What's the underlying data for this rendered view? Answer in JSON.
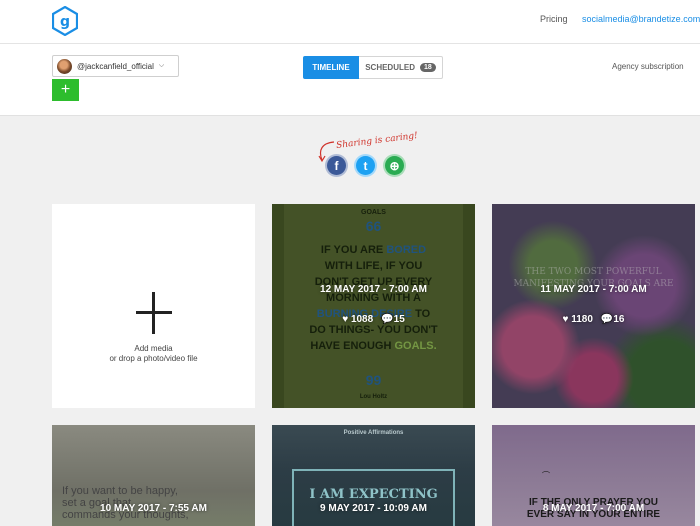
{
  "header": {
    "logo_letter": "g",
    "pricing_label": "Pricing",
    "account_email": "socialmedia@brandetize.com"
  },
  "subheader": {
    "account_handle": "@jackcanfield_official",
    "add_label": "+",
    "tabs": [
      {
        "label": "TIMELINE",
        "active": true
      },
      {
        "label": "SCHEDULED",
        "count": "18",
        "active": false
      }
    ],
    "agency_label": "Agency subscription"
  },
  "share": {
    "caption": "Sharing is caring!",
    "icons": [
      "facebook-icon",
      "twitter-icon",
      "more-share-icon"
    ],
    "facebook_glyph": "f",
    "twitter_glyph": "t",
    "more_glyph": "⊕"
  },
  "add_card": {
    "line1": "Add media",
    "line2": "or drop a photo/video file"
  },
  "posts": [
    {
      "date": "12 MAY 2017 - 7:00 AM",
      "likes": "1088",
      "comments": "15",
      "image": {
        "title": "GOALS",
        "open_mark": "66",
        "close_mark": "99",
        "lines": [
          "IF YOU ARE",
          "BORED",
          "WITH LIFE, IF YOU",
          "DON'T GET UP EVERY",
          "MORNING WITH A",
          "BURNING DESIRE",
          "TO",
          "DO THINGS- YOU DON'T",
          "HAVE ENOUGH",
          "GOALS."
        ],
        "author": "Lou Holtz"
      }
    },
    {
      "date": "11 MAY 2017 - 7:00 AM",
      "likes": "1180",
      "comments": "16",
      "image": {
        "faint_line1": "THE TWO MOST POWERFUL",
        "faint_line2": "MANIFESTING YOUR GOALS ARE"
      }
    },
    {
      "date": "10 MAY 2017 - 7:55 AM",
      "image": {
        "line1": "If you want to be happy,",
        "line2": "set a goal that",
        "line3": "commands your thoughts,"
      }
    },
    {
      "date": "9 MAY 2017 - 10:09 AM",
      "image": {
        "header": "Positive Affirmations",
        "text": "I AM EXPECTING"
      }
    },
    {
      "date": "8 MAY 2017 - 7:00 AM",
      "image": {
        "line1": "IF THE ONLY PRAYER YOU",
        "line2": "EVER SAY IN YOUR ENTIRE"
      }
    }
  ],
  "colors": {
    "accent_blue": "#1a8ee5",
    "add_green": "#2dbd2d",
    "share_red": "#d0342c"
  }
}
